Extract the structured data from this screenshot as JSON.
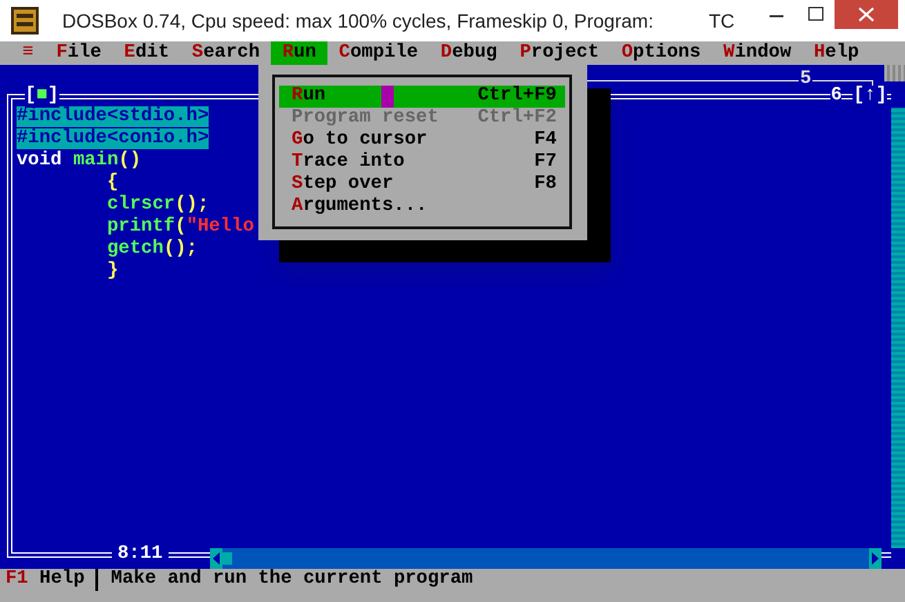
{
  "window": {
    "title": "DOSBox 0.74, Cpu speed: max 100% cycles, Frameskip  0, Program:",
    "program": "TC"
  },
  "menu_bar": {
    "left": [
      {
        "label": "≡",
        "selected": false
      },
      {
        "label": "File",
        "selected": false
      },
      {
        "label": "Edit",
        "selected": false
      },
      {
        "label": "Search",
        "selected": false
      },
      {
        "label": "Run",
        "selected": true
      },
      {
        "label": "Compile",
        "selected": false
      },
      {
        "label": "Debug",
        "selected": false
      },
      {
        "label": "Project",
        "selected": false
      },
      {
        "label": "Options",
        "selected": false
      }
    ],
    "right": [
      {
        "label": "Window",
        "selected": false
      },
      {
        "label": "Help",
        "selected": false
      }
    ]
  },
  "run_menu": {
    "items": [
      {
        "label": "Run",
        "shortcut": "Ctrl+F9",
        "selected": true,
        "disabled": false
      },
      {
        "label": "Program reset",
        "shortcut": "Ctrl+F2",
        "selected": false,
        "disabled": true
      },
      {
        "label": "Go to cursor",
        "shortcut": "F4",
        "selected": false,
        "disabled": false
      },
      {
        "label": "Trace into",
        "shortcut": "F7",
        "selected": false,
        "disabled": false
      },
      {
        "label": "Step over",
        "shortcut": "F8",
        "selected": false,
        "disabled": false
      },
      {
        "label": "Arguments...",
        "selected": false,
        "disabled": false
      }
    ]
  },
  "back_window": {
    "number": "5"
  },
  "editor": {
    "close_box": "[■]",
    "number": "6",
    "zoom_box": "[↑]",
    "cursor_position": "8:11",
    "lines": [
      {
        "tokens": [
          {
            "kind": "preprocessor",
            "text": "#include<stdio.h>"
          }
        ]
      },
      {
        "tokens": [
          {
            "kind": "preprocessor",
            "text": "#include<conio.h>"
          }
        ]
      },
      {
        "tokens": [
          {
            "kind": "keyword",
            "text": "void "
          },
          {
            "kind": "identifier",
            "text": "main"
          },
          {
            "kind": "punctuation",
            "text": "()"
          }
        ]
      },
      {
        "tokens": [
          {
            "kind": "punctuation",
            "text": "        {"
          }
        ]
      },
      {
        "tokens": [
          {
            "kind": "identifier",
            "text": "        clrscr"
          },
          {
            "kind": "punctuation",
            "text": "();"
          }
        ]
      },
      {
        "tokens": [
          {
            "kind": "identifier",
            "text": "        printf"
          },
          {
            "kind": "punctuation",
            "text": "("
          },
          {
            "kind": "string",
            "text": "\"Hello"
          }
        ]
      },
      {
        "tokens": [
          {
            "kind": "identifier",
            "text": "        getch"
          },
          {
            "kind": "punctuation",
            "text": "();"
          }
        ]
      },
      {
        "tokens": [
          {
            "kind": "punctuation",
            "text": "        }"
          }
        ]
      }
    ]
  },
  "status_bar": {
    "key": "F1",
    "key_label": "Help",
    "message": "Make and run the current program"
  }
}
